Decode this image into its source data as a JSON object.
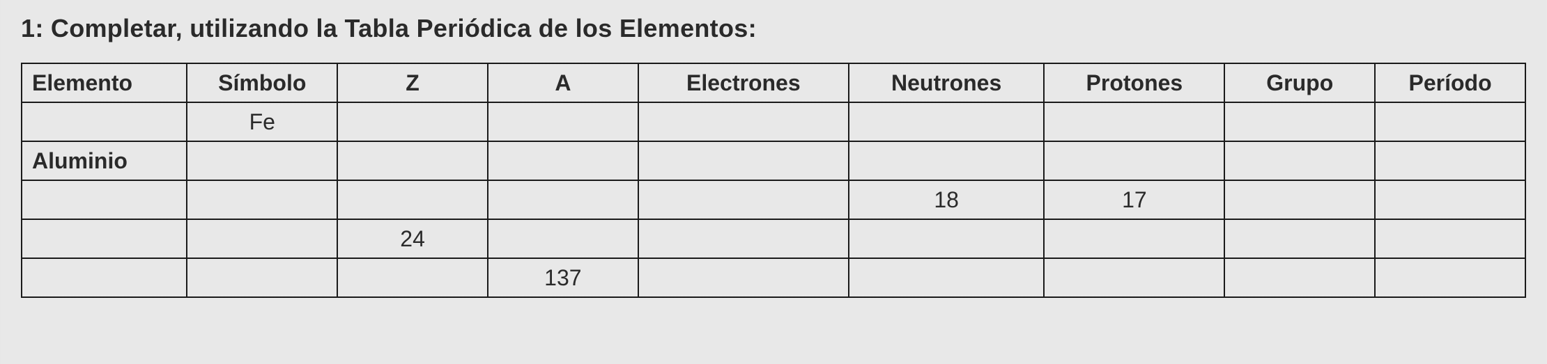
{
  "instruction": "1: Completar, utilizando la Tabla Periódica de los Elementos:",
  "headers": {
    "elemento": "Elemento",
    "simbolo": "Símbolo",
    "z": "Z",
    "a": "A",
    "electrones": "Electrones",
    "neutrones": "Neutrones",
    "protones": "Protones",
    "grupo": "Grupo",
    "periodo": "Período"
  },
  "rows": [
    {
      "elemento": "",
      "simbolo": "Fe",
      "z": "",
      "a": "",
      "electrones": "",
      "neutrones": "",
      "protones": "",
      "grupo": "",
      "periodo": ""
    },
    {
      "elemento": "Aluminio",
      "simbolo": "",
      "z": "",
      "a": "",
      "electrones": "",
      "neutrones": "",
      "protones": "",
      "grupo": "",
      "periodo": ""
    },
    {
      "elemento": "",
      "simbolo": "",
      "z": "",
      "a": "",
      "electrones": "",
      "neutrones": "18",
      "protones": "17",
      "grupo": "",
      "periodo": ""
    },
    {
      "elemento": "",
      "simbolo": "",
      "z": "24",
      "a": "",
      "electrones": "",
      "neutrones": "",
      "protones": "",
      "grupo": "",
      "periodo": ""
    },
    {
      "elemento": "",
      "simbolo": "",
      "z": "",
      "a": "137",
      "electrones": "",
      "neutrones": "",
      "protones": "",
      "grupo": "",
      "periodo": ""
    }
  ]
}
